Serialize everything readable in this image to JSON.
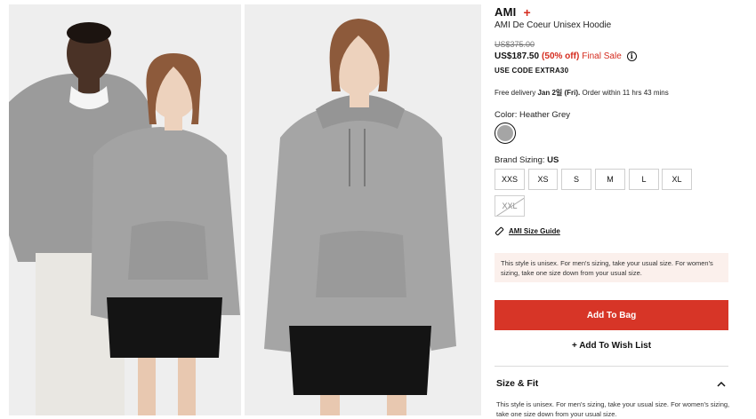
{
  "gallery": {
    "images": [
      {
        "alt_icon": "product-photo-models-pair"
      },
      {
        "alt_icon": "product-photo-model-single"
      }
    ]
  },
  "product": {
    "brand": "AMI",
    "name": "AMI De Coeur Unisex Hoodie",
    "original_price": "US$375.00",
    "price": "US$187.50",
    "discount": "(50% off)",
    "final_sale": "Final Sale",
    "promo_code": "USE CODE EXTRA30"
  },
  "delivery": {
    "prefix": "Free delivery ",
    "date": "Jan 2일 (Fri).",
    "suffix": " Order within 11 hrs 43 mins"
  },
  "color": {
    "label": "Color: Heather Grey",
    "swatch_hex": "#a5a5a5"
  },
  "sizing": {
    "label_prefix": "Brand Sizing: ",
    "label_value": "US",
    "sizes": [
      {
        "label": "XXS",
        "available": true
      },
      {
        "label": "XS",
        "available": true
      },
      {
        "label": "S",
        "available": true
      },
      {
        "label": "M",
        "available": true
      },
      {
        "label": "L",
        "available": true
      },
      {
        "label": "XL",
        "available": true
      },
      {
        "label": "XXL",
        "available": false
      }
    ],
    "guide_label": "AMI Size Guide"
  },
  "notice": "This style is unisex. For men's sizing, take your usual size. For women's sizing, take one size down from your usual size.",
  "actions": {
    "add_to_bag": "Add To Bag",
    "add_to_wish": "+ Add To Wish List"
  },
  "size_fit": {
    "title": "Size & Fit",
    "body": "This style is unisex. For men's sizing, take your usual size. For women's sizing, take one size down from your usual size."
  },
  "colors": {
    "accent": "#d73527",
    "sale_red": "#d52b1e",
    "notice_bg": "#fbf0ec"
  }
}
